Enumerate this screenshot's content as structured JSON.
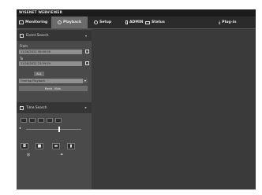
{
  "brand": {
    "title": "WISENET WEBVIEWER"
  },
  "nav": {
    "monitoring": "Monitoring",
    "playback": "Playback",
    "setup": "Setup",
    "user": "ADMIN",
    "status": "Status",
    "plugin": "Plug-in"
  },
  "event_search": {
    "title": "Event Search",
    "from_label": "From",
    "from_value": "11/16/2022 00:00:00",
    "to_label": "To",
    "to_value": "11/16/2022 23:59:59",
    "button_all": "ALL",
    "select_value": "Overlap Playback",
    "search_button": "Rech. Vbls."
  },
  "time_search": {
    "title": "Time Search"
  },
  "playback": {
    "volume_level": 0.6
  },
  "colors": {
    "background": "#3a3a3a",
    "active_tab": "#6a6a6a",
    "sidebar": "#4a4a4a"
  }
}
